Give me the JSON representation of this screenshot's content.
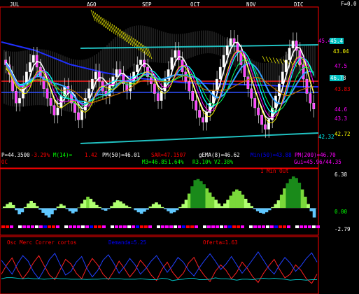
{
  "chart_data": {
    "type": "line",
    "header": {
      "f_label": "F=0.0"
    },
    "months": [
      "JUL",
      "AGO",
      "SEP",
      "OCT",
      "NOV",
      "DIC"
    ],
    "price_labels": [
      {
        "text": "45.46",
        "color": "#ff00ff",
        "y": 45.46
      },
      {
        "text": "45.4",
        "color": "#00ffff",
        "boxed": true,
        "y": 45.4
      },
      {
        "text": "43.04",
        "color": "#ffff00",
        "y": 43.04
      },
      {
        "text": "47.5",
        "color": "#ff00ff",
        "y": 47.5
      },
      {
        "text": "46.78",
        "color": "#00ffff",
        "boxed": true,
        "y": 46.78
      },
      {
        "text": "43.83",
        "color": "#ff0000",
        "y": 43.83
      },
      {
        "text": "44.6",
        "color": "#ff00ff",
        "y": 44.6
      },
      {
        "text": "43.3",
        "color": "#ff00ff",
        "y": 43.3
      },
      {
        "text": "42.32",
        "color": "#00ffff",
        "y": 42.32
      },
      {
        "text": "42.72",
        "color": "#ffff00",
        "y": 42.72
      }
    ],
    "indicators": [
      {
        "text": "P=44.3500",
        "color": "#ffffff"
      },
      {
        "text": "-3.29%",
        "color": "#ff0000"
      },
      {
        "text": "M(14)=",
        "color": "#00ff00"
      },
      {
        "text": "1.42",
        "color": "#ff0000"
      },
      {
        "text": "PM(50)=46.01",
        "color": "#ffffff"
      },
      {
        "text": "SAR=47.1507",
        "color": "#ff0000"
      },
      {
        "text": "gEMA(8)=46.62",
        "color": "#ffffff"
      },
      {
        "text": "Min(50)=43.88",
        "color": "#0000ff"
      },
      {
        "text": "PM(200)=46.70",
        "color": "#ff00ff"
      },
      {
        "text": "OC",
        "color": "#ff0000"
      },
      {
        "text": "M3=46.85",
        "color": "#00ff00"
      },
      {
        "text": "1.64%",
        "color": "#00ff00"
      },
      {
        "text": "R3.10%",
        "color": "#00ff00"
      },
      {
        "text": "V2.38%",
        "color": "#00ff00"
      },
      {
        "text": "Gui=45.96/44.35",
        "color": "#ff00ff"
      }
    ],
    "oscillator": {
      "title": "1 Min Out",
      "yticks": [
        {
          "text": "6.38",
          "value": 6.38
        },
        {
          "text": "0.00",
          "value": 0.0
        },
        {
          "text": "-2.79",
          "value": -2.79
        }
      ],
      "ylim": [
        -2.79,
        6.38
      ],
      "values": [
        0.3,
        0.8,
        1.1,
        0.6,
        -0.4,
        -1.2,
        -0.8,
        0.2,
        0.9,
        1.4,
        1.0,
        0.4,
        -0.3,
        -0.9,
        -1.4,
        -1.8,
        -1.2,
        -0.4,
        0.3,
        0.8,
        0.5,
        -0.2,
        -0.6,
        -1.0,
        -0.7,
        0.1,
        0.9,
        1.6,
        2.2,
        1.8,
        1.2,
        0.6,
        0.2,
        -0.3,
        -0.5,
        -0.2,
        0.4,
        1.1,
        1.5,
        1.3,
        0.9,
        0.5,
        0.2,
        0.0,
        -0.4,
        -0.8,
        -1.1,
        -0.7,
        -0.3,
        0.3,
        0.8,
        1.1,
        0.7,
        0.2,
        -0.2,
        -0.6,
        -1.0,
        -0.8,
        -0.4,
        0.2,
        0.8,
        1.6,
        2.8,
        4.2,
        5.4,
        5.6,
        5.2,
        4.6,
        3.8,
        3.0,
        2.2,
        1.6,
        0.9,
        0.4,
        0.9,
        1.6,
        2.4,
        3.2,
        3.6,
        3.3,
        2.6,
        1.8,
        1.0,
        0.4,
        -0.2,
        -0.6,
        -0.9,
        -1.1,
        -0.8,
        -0.4,
        0.2,
        0.8,
        1.5,
        2.6,
        3.8,
        4.8,
        5.6,
        6.1,
        5.8,
        4.9,
        3.6,
        2.2,
        0.8,
        -0.6,
        -1.8
      ]
    },
    "volume_panel": {
      "labels": [
        {
          "text": "Osc Merc Correr cortos",
          "color": "#ff0000"
        },
        {
          "text": "Demanda=5.25",
          "color": "#0000ff"
        },
        {
          "text": "Oferta=1.63",
          "color": "#ff0000"
        }
      ],
      "demand": [
        70,
        55,
        40,
        62,
        80,
        68,
        45,
        30,
        50,
        72,
        85,
        60,
        38,
        46,
        66,
        78,
        52,
        34,
        48,
        70,
        82,
        64,
        42,
        56,
        74,
        60,
        40,
        52,
        68,
        80,
        62,
        44,
        58,
        76,
        66,
        48,
        36,
        54,
        70,
        84,
        68,
        50,
        62,
        78,
        60,
        42,
        56,
        72,
        88,
        70,
        52,
        40,
        60,
        76,
        64,
        46,
        58,
        74,
        86,
        66
      ],
      "supply": [
        40,
        60,
        75,
        50,
        30,
        45,
        65,
        80,
        58,
        38,
        28,
        50,
        72,
        62,
        42,
        30,
        55,
        74,
        60,
        40,
        28,
        46,
        68,
        52,
        34,
        48,
        70,
        56,
        38,
        26,
        50,
        66,
        44,
        30,
        42,
        64,
        76,
        52,
        36,
        24,
        46,
        60,
        48,
        30,
        44,
        66,
        52,
        34,
        22,
        42,
        58,
        72,
        50,
        32,
        40,
        60,
        48,
        30,
        20,
        40
      ]
    },
    "price": {
      "ylim": [
        42.0,
        48.5
      ],
      "close": [
        46.2,
        45.8,
        45.1,
        44.6,
        44.8,
        45.4,
        45.9,
        46.3,
        46.6,
        46.1,
        45.7,
        45.2,
        44.8,
        44.5,
        44.1,
        44.4,
        44.9,
        45.3,
        45.0,
        44.6,
        44.2,
        43.9,
        44.3,
        44.8,
        45.2,
        45.6,
        45.9,
        45.5,
        45.1,
        44.9,
        45.3,
        45.7,
        46.0,
        45.8,
        45.4,
        45.1,
        45.5,
        45.9,
        46.2,
        46.4,
        46.1,
        45.7,
        45.4,
        45.0,
        44.7,
        45.1,
        45.6,
        46.0,
        46.5,
        46.8,
        46.4,
        45.9,
        45.5,
        45.1,
        44.7,
        44.3,
        44.0,
        43.8,
        44.2,
        44.6,
        45.1,
        45.6,
        46.1,
        46.6,
        47.0,
        47.3,
        47.1,
        46.7,
        46.2,
        45.7,
        45.2,
        44.8,
        44.4,
        44.1,
        43.7,
        43.5,
        43.9,
        44.4,
        44.9,
        45.4,
        45.9,
        46.4,
        46.9,
        47.2,
        46.8,
        46.2,
        45.6,
        45.0,
        44.6,
        44.35
      ]
    }
  }
}
